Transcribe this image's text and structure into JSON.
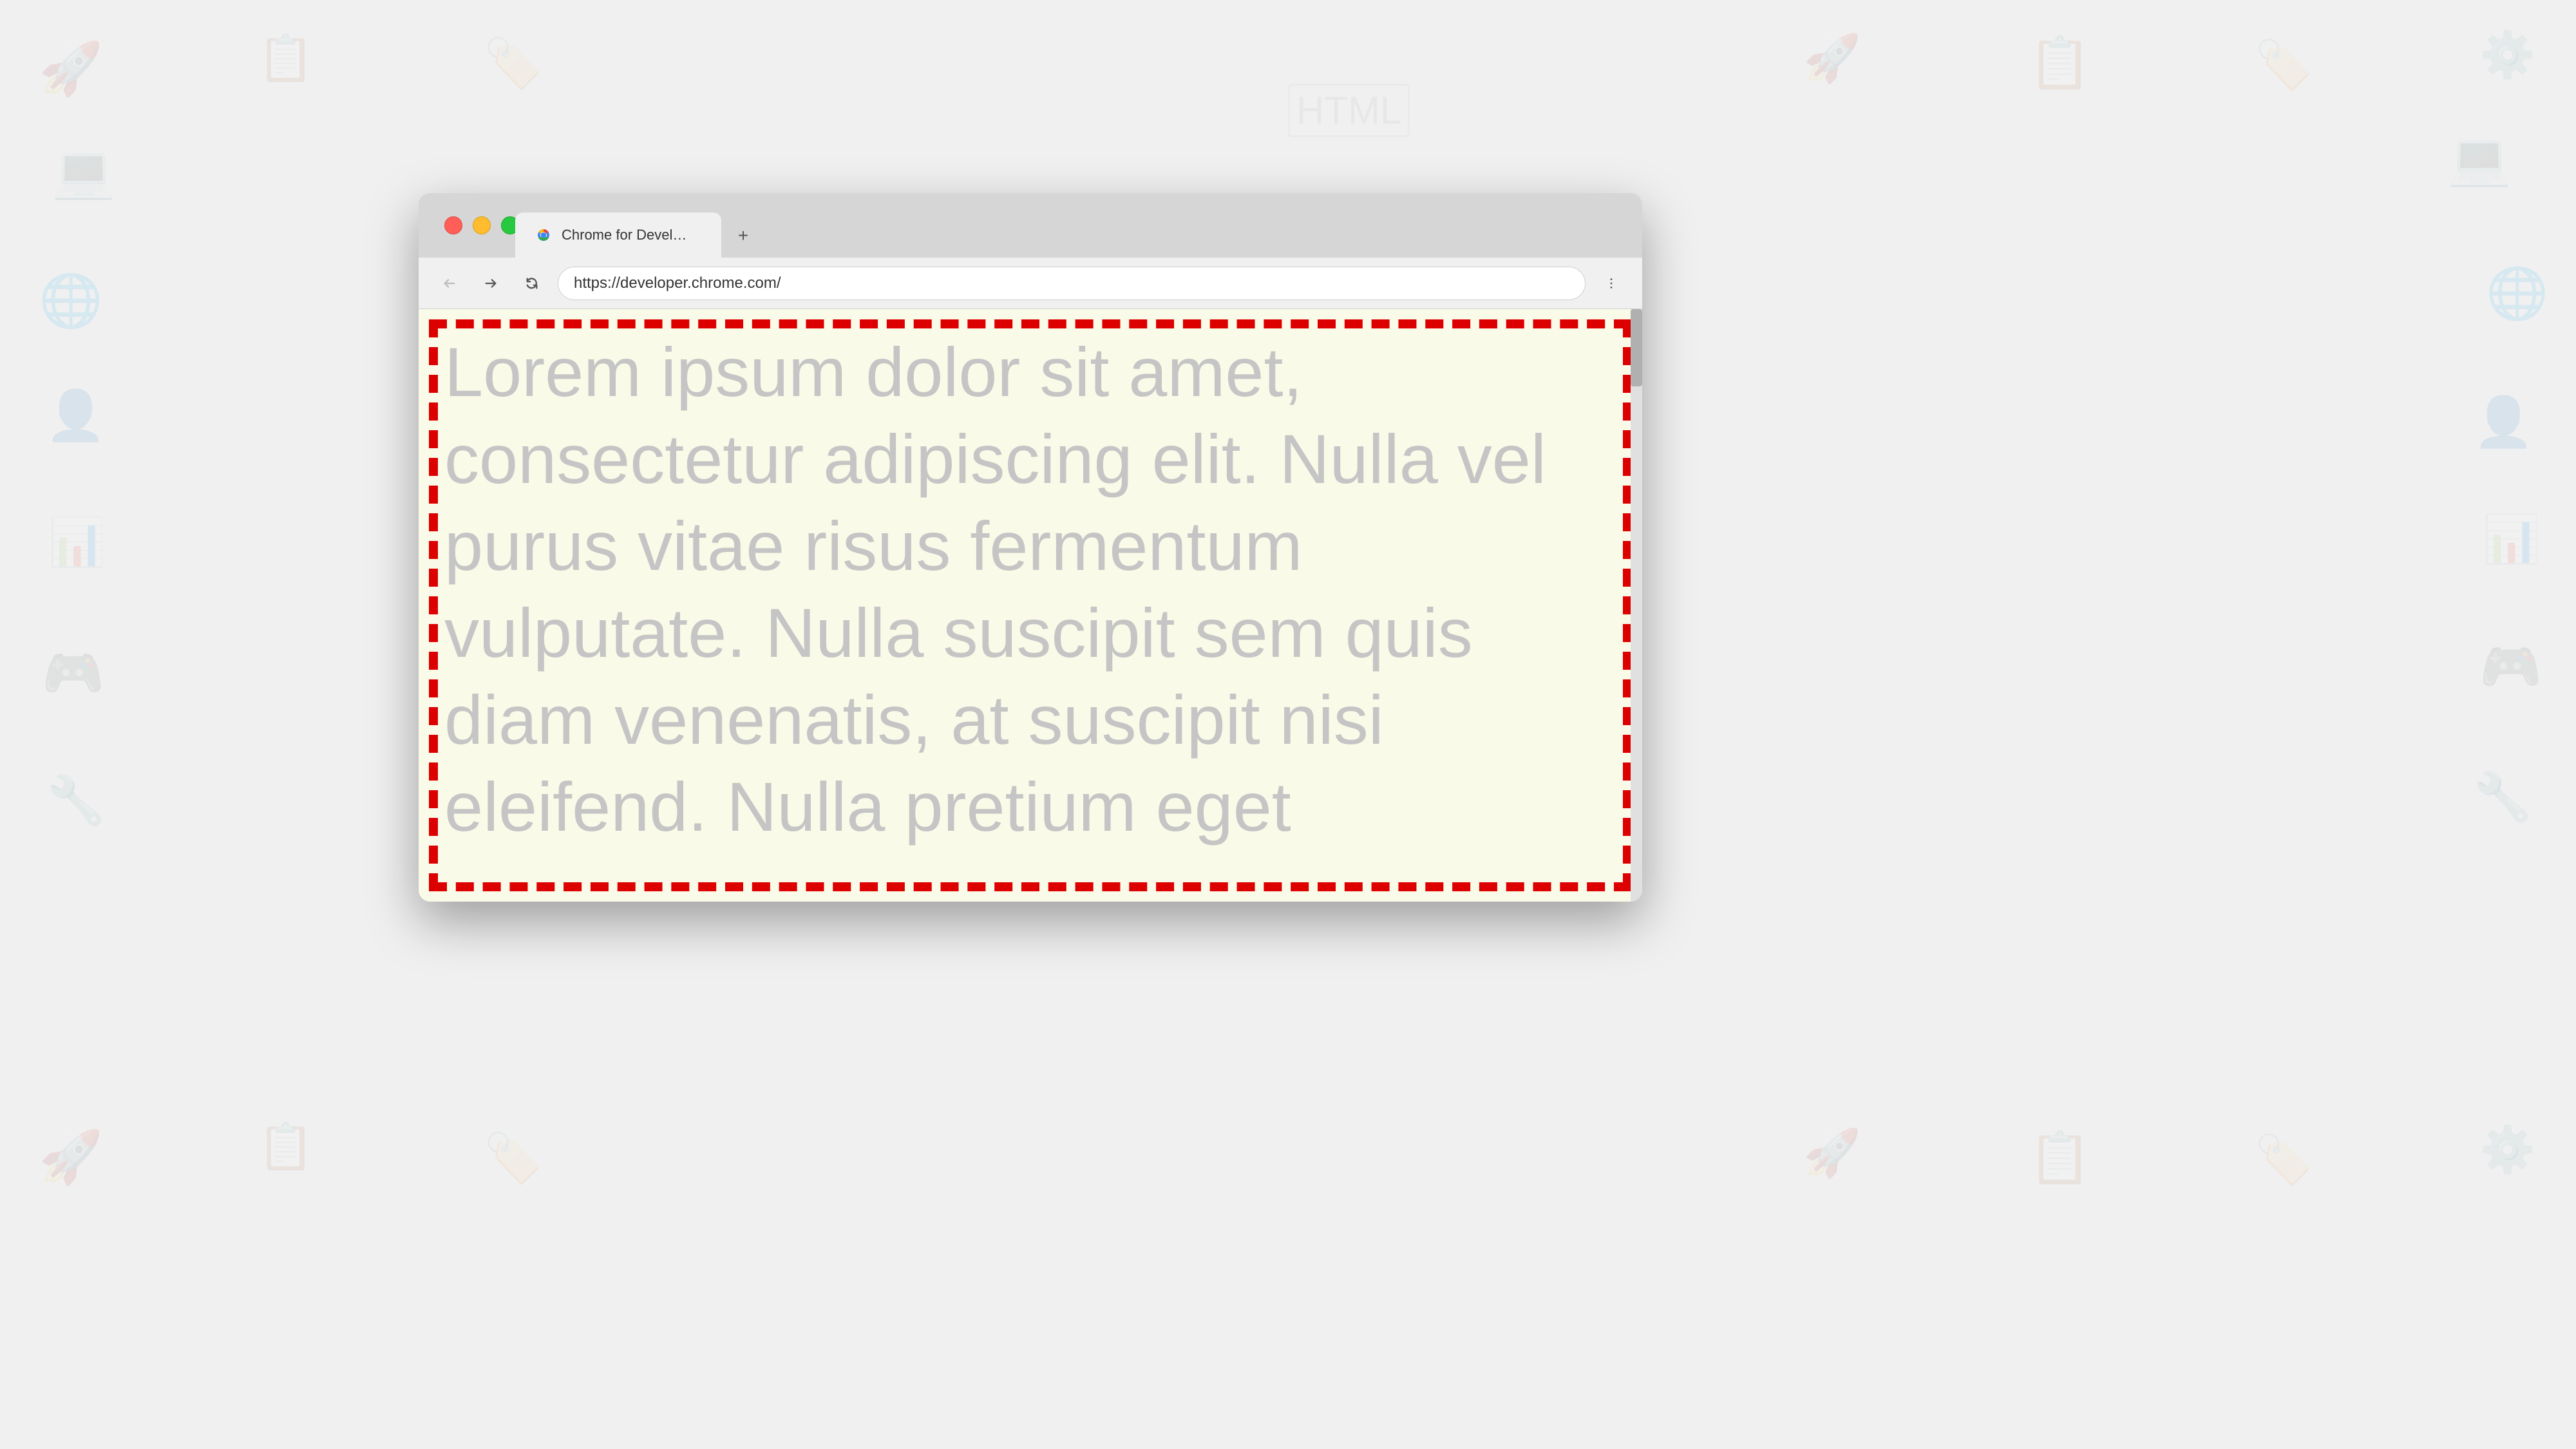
{
  "background": {
    "color": "#f0f0f0"
  },
  "browser": {
    "tab": {
      "favicon_alt": "Chrome for Developers logo",
      "title": "Chrome for Developers",
      "new_tab_icon": "+"
    },
    "toolbar": {
      "back_button_label": "←",
      "forward_button_label": "→",
      "reload_button_label": "↻",
      "address": "https://developer.chrome.com/",
      "menu_icon": "⋮"
    },
    "traffic_lights": {
      "red_label": "close",
      "yellow_label": "minimize",
      "green_label": "maximize"
    }
  },
  "viewport": {
    "background_color": "#fafae8",
    "border_color": "#dd0000",
    "content_text": "Lorem ipsum dolor sit amet, consectetur adipiscing elit. Nulla vel purus vitae risus fermentum vulputate. Nulla suscipit sem quis diam venenatis, at suscipit nisi eleifend. Nulla pretium eget",
    "text_color": "#c5c5c5"
  }
}
